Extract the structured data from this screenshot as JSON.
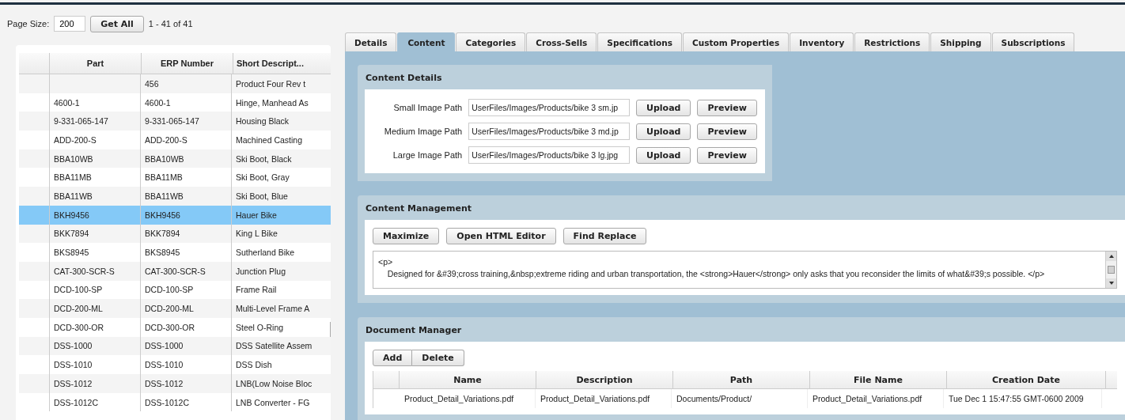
{
  "page_size": {
    "label": "Page Size:",
    "value": "200"
  },
  "get_all_button": "Get All",
  "paging": "1 - 41 of 41",
  "parts_grid": {
    "columns": [
      "Part",
      "ERP Number",
      "Short Descript..."
    ],
    "rows": [
      {
        "part": "",
        "erp": "456",
        "description": "Product Four Rev t",
        "selected": false
      },
      {
        "part": "4600-1",
        "erp": "4600-1",
        "description": "Hinge, Manhead As",
        "selected": false
      },
      {
        "part": "9-331-065-147",
        "erp": "9-331-065-147",
        "description": "Housing Black",
        "selected": false
      },
      {
        "part": "ADD-200-S",
        "erp": "ADD-200-S",
        "description": "Machined Casting",
        "selected": false
      },
      {
        "part": "BBA10WB",
        "erp": "BBA10WB",
        "description": "Ski Boot, Black",
        "selected": false
      },
      {
        "part": "BBA11MB",
        "erp": "BBA11MB",
        "description": "Ski Boot, Gray",
        "selected": false
      },
      {
        "part": "BBA11WB",
        "erp": "BBA11WB",
        "description": "Ski Boot, Blue",
        "selected": false
      },
      {
        "part": "BKH9456",
        "erp": "BKH9456",
        "description": "Hauer Bike",
        "selected": true
      },
      {
        "part": "BKK7894",
        "erp": "BKK7894",
        "description": "King L Bike",
        "selected": false
      },
      {
        "part": "BKS8945",
        "erp": "BKS8945",
        "description": "Sutherland Bike",
        "selected": false
      },
      {
        "part": "CAT-300-SCR-S",
        "erp": "CAT-300-SCR-S",
        "description": "Junction Plug",
        "selected": false
      },
      {
        "part": "DCD-100-SP",
        "erp": "DCD-100-SP",
        "description": "Frame Rail",
        "selected": false
      },
      {
        "part": "DCD-200-ML",
        "erp": "DCD-200-ML",
        "description": "Multi-Level Frame A",
        "selected": false
      },
      {
        "part": "DCD-300-OR",
        "erp": "DCD-300-OR",
        "description": "Steel O-Ring",
        "selected": false
      },
      {
        "part": "DSS-1000",
        "erp": "DSS-1000",
        "description": "DSS Satellite Assem",
        "selected": false
      },
      {
        "part": "DSS-1010",
        "erp": "DSS-1010",
        "description": "DSS Dish",
        "selected": false
      },
      {
        "part": "DSS-1012",
        "erp": "DSS-1012",
        "description": "LNB(Low Noise Bloc",
        "selected": false
      },
      {
        "part": "DSS-1012C",
        "erp": "DSS-1012C",
        "description": "LNB Converter - FG",
        "selected": false
      }
    ]
  },
  "tabs": [
    {
      "label": "Details",
      "selected": false
    },
    {
      "label": "Content",
      "selected": true
    },
    {
      "label": "Categories",
      "selected": false
    },
    {
      "label": "Cross-Sells",
      "selected": false
    },
    {
      "label": "Specifications",
      "selected": false
    },
    {
      "label": "Custom Properties",
      "selected": false
    },
    {
      "label": "Inventory",
      "selected": false
    },
    {
      "label": "Restrictions",
      "selected": false
    },
    {
      "label": "Shipping",
      "selected": false
    },
    {
      "label": "Subscriptions",
      "selected": false
    }
  ],
  "content_details": {
    "title": "Content Details",
    "rows": [
      {
        "label": "Small Image Path",
        "value": "UserFiles/Images/Products/bike 3 sm.jp",
        "upload": "Upload",
        "preview": "Preview"
      },
      {
        "label": "Medium Image Path",
        "value": "UserFiles/Images/Products/bike 3 md.jp",
        "upload": "Upload",
        "preview": "Preview"
      },
      {
        "label": "Large Image Path",
        "value": "UserFiles/Images/Products/bike 3 lg.jpg",
        "upload": "Upload",
        "preview": "Preview"
      }
    ]
  },
  "content_management": {
    "title": "Content Management",
    "buttons": [
      "Maximize",
      "Open HTML Editor",
      "Find Replace"
    ],
    "editor_lines": [
      "<p>",
      "    Designed for &#39;cross training,&nbsp;extreme riding and urban transportation, the <strong>Hauer</strong> only asks that you reconsider the limits of what&#39;s possible. </p>"
    ]
  },
  "document_manager": {
    "title": "Document Manager",
    "buttons": [
      "Add",
      "Delete"
    ],
    "columns": [
      "Name",
      "Description",
      "Path",
      "File Name",
      "Creation Date"
    ],
    "rows": [
      [
        "Product_Detail_Variations.pdf",
        "Product_Detail_Variations.pdf",
        "Documents/Product/",
        "Product_Detail_Variations.pdf",
        "Tue Dec 1 15:47:55 GMT-0600 2009"
      ]
    ]
  }
}
